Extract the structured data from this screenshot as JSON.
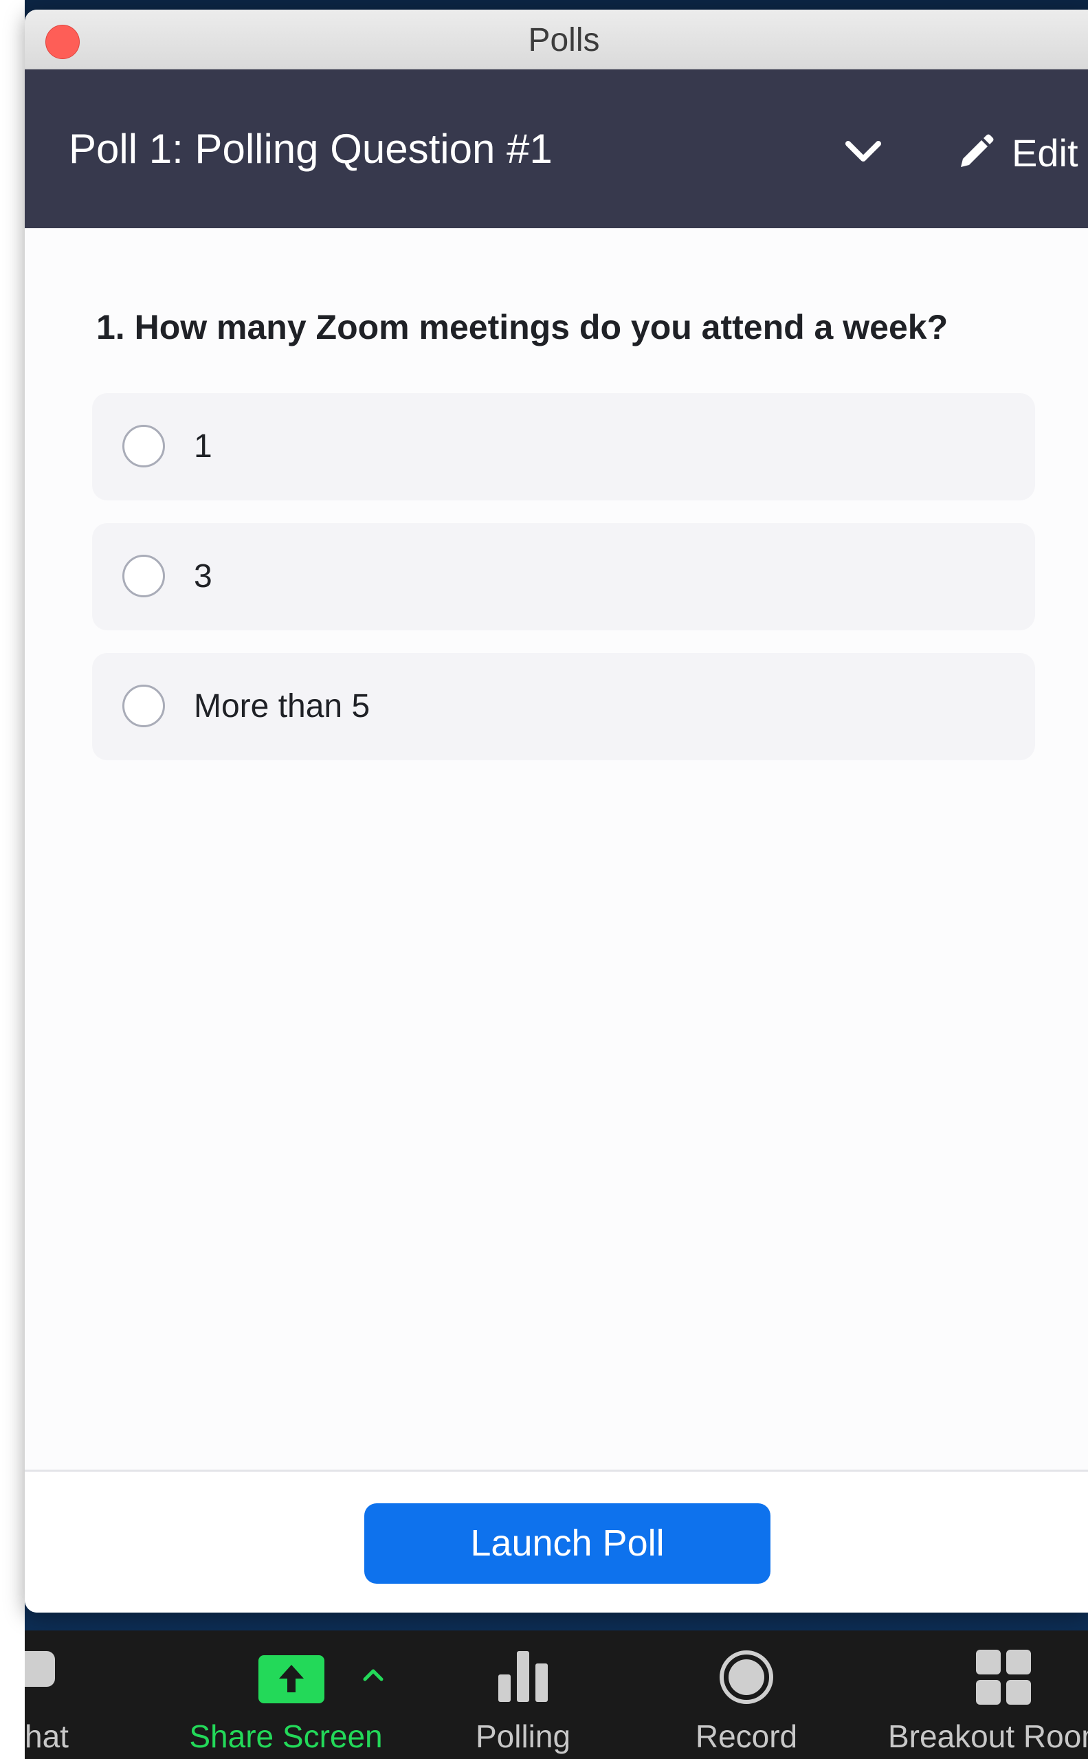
{
  "window": {
    "title": "Polls"
  },
  "poll": {
    "header_title": "Poll 1: Polling Question #1",
    "edit_label": "Edit",
    "question": "1. How many Zoom meetings do you attend a week?",
    "options": [
      {
        "label": "1"
      },
      {
        "label": "3"
      },
      {
        "label": "More than 5"
      }
    ],
    "launch_label": "Launch Poll"
  },
  "toolbar": {
    "items": [
      {
        "label": "hat",
        "icon": "chat-icon"
      },
      {
        "label": "Share Screen",
        "icon": "share-screen-icon"
      },
      {
        "label": "Polling",
        "icon": "polling-icon"
      },
      {
        "label": "Record",
        "icon": "record-icon"
      },
      {
        "label": "Breakout Room",
        "icon": "breakout-rooms-icon"
      }
    ]
  },
  "colors": {
    "header_bg": "#37394d",
    "accent_blue": "#0e72ed",
    "share_green": "#23d959",
    "close_red": "#fe5e57"
  }
}
